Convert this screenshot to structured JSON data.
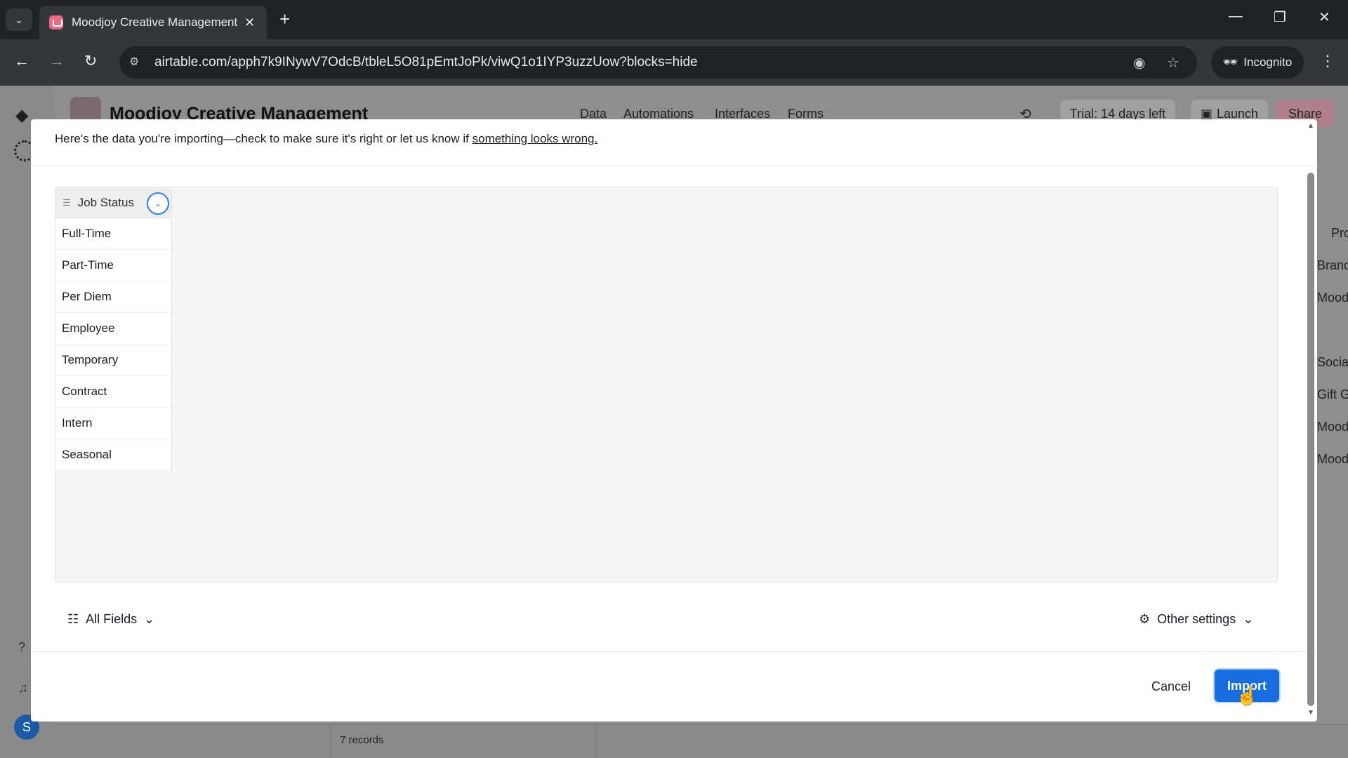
{
  "browser": {
    "tab_title": "Moodjoy Creative Management",
    "url": "airtable.com/apph7k9INywV7OdcB/tbleL5O81pEmtJoPk/viwQ1o1IYP3uzzUow?blocks=hide",
    "incognito_label": "Incognito"
  },
  "app": {
    "base_name": "Moodjoy Creative Management",
    "nav": [
      "Data",
      "Automations",
      "Interfaces",
      "Forms"
    ],
    "trial_label": "Trial: 14 days left",
    "launch_label": "Launch",
    "share_label": "Share",
    "user_initial": "S",
    "background_rows": [
      "Pro",
      "Brand",
      "Mood",
      "Social",
      "Gift G",
      "Mood",
      "Mood"
    ],
    "records_label": "7 records"
  },
  "modal": {
    "intro_text": "Here's the data you're importing—check to make sure it's right or let us know if ",
    "intro_link": "something looks wrong.",
    "field": {
      "name": "Job Status",
      "values": [
        "Full-Time",
        "Part-Time",
        "Per Diem",
        "Employee",
        "Temporary",
        "Contract",
        "Intern",
        "Seasonal"
      ]
    },
    "all_fields_label": "All Fields",
    "other_settings_label": "Other settings",
    "cancel_label": "Cancel",
    "import_label": "Import"
  },
  "colors": {
    "accent": "#166ee1",
    "toggle_ring": "#2d7ff9",
    "chrome_dark": "#202124"
  },
  "icons": [
    "tab-search-icon",
    "close-icon",
    "plus-icon",
    "back-icon",
    "forward-icon",
    "reload-icon",
    "site-info-icon",
    "eye-off-icon",
    "star-icon",
    "incognito-icon",
    "more-vert-icon",
    "history-icon",
    "launch-icon",
    "list-icon",
    "chevron-down-icon",
    "gear-icon",
    "cursor-icon"
  ]
}
